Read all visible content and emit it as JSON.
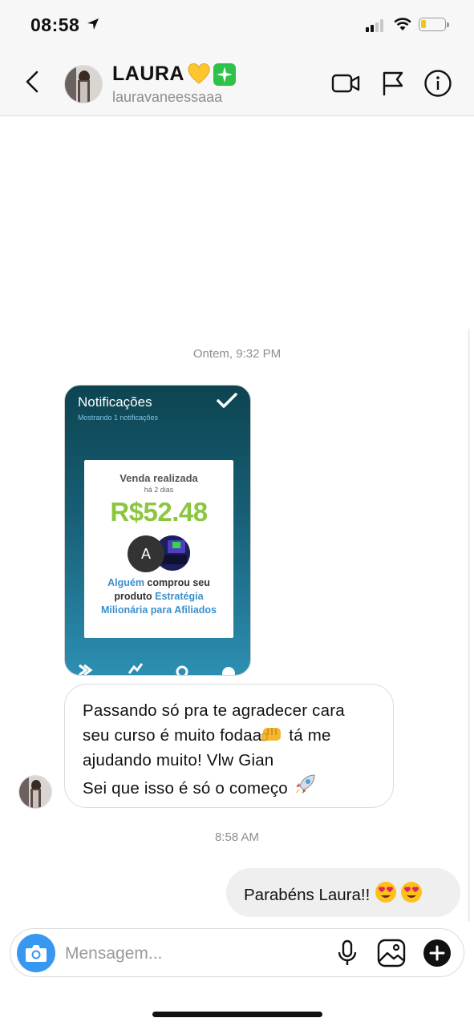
{
  "status_bar": {
    "time": "08:58"
  },
  "header": {
    "name": "LAURA",
    "username": "lauravaneessaaa"
  },
  "conversation": {
    "timestamp_1": "Ontem, 9:32 PM",
    "shared_image": {
      "title": "Notificações",
      "subtitle": "Mostrando 1 notificações",
      "sale_title": "Venda realizada",
      "sale_time": "há 2 dias",
      "amount": "R$52.48",
      "buyer_initial": "A",
      "desc_part1": "Alguém",
      "desc_part2": " comprou seu produto ",
      "desc_part3": "Estratégia Milionária para Afiliados"
    },
    "incoming_message": {
      "line1": "Passando só pra te agradecer cara",
      "line2": "seu curso é muito fodaa",
      "line2_after": " tá me",
      "line3": "ajudando muito! Vlw Gian",
      "line4": "Sei que isso é só o começo "
    },
    "timestamp_2": "8:58 AM",
    "outgoing_message": {
      "text": "Parabéns Laura!! "
    }
  },
  "composer": {
    "placeholder": "Mensagem..."
  },
  "colors": {
    "accent_blue": "#3897f0",
    "amount_green": "#8cc63f",
    "highlight_blue": "#3a8fcd",
    "bubble_gray": "#efefef"
  },
  "icons": [
    "location-arrow-icon",
    "signal-icon",
    "wifi-icon",
    "battery-icon",
    "back-chevron-icon",
    "yellow-heart-icon",
    "sparkles-icon",
    "video-call-icon",
    "flag-icon",
    "info-icon",
    "check-icon",
    "fist-icon",
    "rocket-icon",
    "heart-eyes-icon",
    "camera-icon",
    "microphone-icon",
    "gallery-icon",
    "plus-icon"
  ]
}
